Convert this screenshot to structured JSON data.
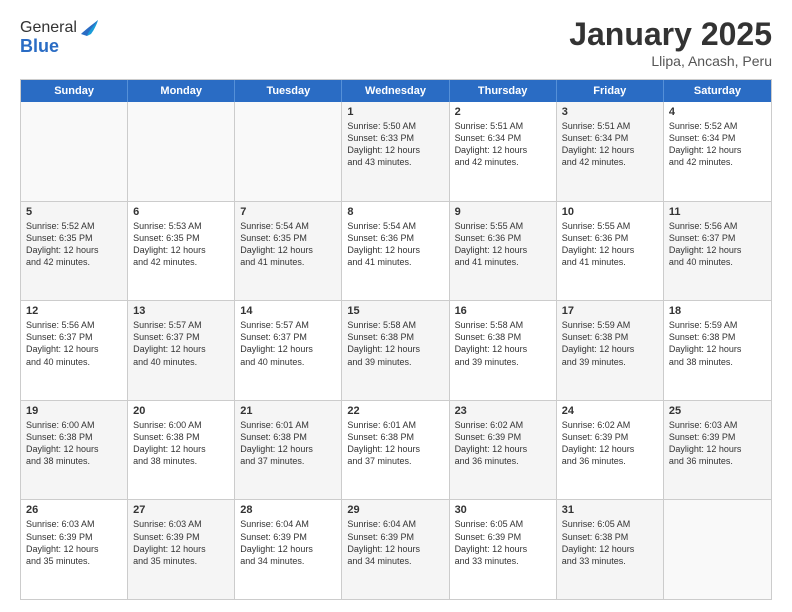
{
  "header": {
    "logo_general": "General",
    "logo_blue": "Blue",
    "title": "January 2025",
    "subtitle": "Llipa, Ancash, Peru"
  },
  "days": [
    "Sunday",
    "Monday",
    "Tuesday",
    "Wednesday",
    "Thursday",
    "Friday",
    "Saturday"
  ],
  "rows": [
    [
      {
        "num": "",
        "text": "",
        "empty": true
      },
      {
        "num": "",
        "text": "",
        "empty": true
      },
      {
        "num": "",
        "text": "",
        "empty": true
      },
      {
        "num": "1",
        "text": "Sunrise: 5:50 AM\nSunset: 6:33 PM\nDaylight: 12 hours\nand 43 minutes.",
        "shaded": true
      },
      {
        "num": "2",
        "text": "Sunrise: 5:51 AM\nSunset: 6:34 PM\nDaylight: 12 hours\nand 42 minutes."
      },
      {
        "num": "3",
        "text": "Sunrise: 5:51 AM\nSunset: 6:34 PM\nDaylight: 12 hours\nand 42 minutes.",
        "shaded": true
      },
      {
        "num": "4",
        "text": "Sunrise: 5:52 AM\nSunset: 6:34 PM\nDaylight: 12 hours\nand 42 minutes."
      }
    ],
    [
      {
        "num": "5",
        "text": "Sunrise: 5:52 AM\nSunset: 6:35 PM\nDaylight: 12 hours\nand 42 minutes.",
        "shaded": true
      },
      {
        "num": "6",
        "text": "Sunrise: 5:53 AM\nSunset: 6:35 PM\nDaylight: 12 hours\nand 42 minutes."
      },
      {
        "num": "7",
        "text": "Sunrise: 5:54 AM\nSunset: 6:35 PM\nDaylight: 12 hours\nand 41 minutes.",
        "shaded": true
      },
      {
        "num": "8",
        "text": "Sunrise: 5:54 AM\nSunset: 6:36 PM\nDaylight: 12 hours\nand 41 minutes."
      },
      {
        "num": "9",
        "text": "Sunrise: 5:55 AM\nSunset: 6:36 PM\nDaylight: 12 hours\nand 41 minutes.",
        "shaded": true
      },
      {
        "num": "10",
        "text": "Sunrise: 5:55 AM\nSunset: 6:36 PM\nDaylight: 12 hours\nand 41 minutes."
      },
      {
        "num": "11",
        "text": "Sunrise: 5:56 AM\nSunset: 6:37 PM\nDaylight: 12 hours\nand 40 minutes.",
        "shaded": true
      }
    ],
    [
      {
        "num": "12",
        "text": "Sunrise: 5:56 AM\nSunset: 6:37 PM\nDaylight: 12 hours\nand 40 minutes."
      },
      {
        "num": "13",
        "text": "Sunrise: 5:57 AM\nSunset: 6:37 PM\nDaylight: 12 hours\nand 40 minutes.",
        "shaded": true
      },
      {
        "num": "14",
        "text": "Sunrise: 5:57 AM\nSunset: 6:37 PM\nDaylight: 12 hours\nand 40 minutes."
      },
      {
        "num": "15",
        "text": "Sunrise: 5:58 AM\nSunset: 6:38 PM\nDaylight: 12 hours\nand 39 minutes.",
        "shaded": true
      },
      {
        "num": "16",
        "text": "Sunrise: 5:58 AM\nSunset: 6:38 PM\nDaylight: 12 hours\nand 39 minutes."
      },
      {
        "num": "17",
        "text": "Sunrise: 5:59 AM\nSunset: 6:38 PM\nDaylight: 12 hours\nand 39 minutes.",
        "shaded": true
      },
      {
        "num": "18",
        "text": "Sunrise: 5:59 AM\nSunset: 6:38 PM\nDaylight: 12 hours\nand 38 minutes."
      }
    ],
    [
      {
        "num": "19",
        "text": "Sunrise: 6:00 AM\nSunset: 6:38 PM\nDaylight: 12 hours\nand 38 minutes.",
        "shaded": true
      },
      {
        "num": "20",
        "text": "Sunrise: 6:00 AM\nSunset: 6:38 PM\nDaylight: 12 hours\nand 38 minutes."
      },
      {
        "num": "21",
        "text": "Sunrise: 6:01 AM\nSunset: 6:38 PM\nDaylight: 12 hours\nand 37 minutes.",
        "shaded": true
      },
      {
        "num": "22",
        "text": "Sunrise: 6:01 AM\nSunset: 6:38 PM\nDaylight: 12 hours\nand 37 minutes."
      },
      {
        "num": "23",
        "text": "Sunrise: 6:02 AM\nSunset: 6:39 PM\nDaylight: 12 hours\nand 36 minutes.",
        "shaded": true
      },
      {
        "num": "24",
        "text": "Sunrise: 6:02 AM\nSunset: 6:39 PM\nDaylight: 12 hours\nand 36 minutes."
      },
      {
        "num": "25",
        "text": "Sunrise: 6:03 AM\nSunset: 6:39 PM\nDaylight: 12 hours\nand 36 minutes.",
        "shaded": true
      }
    ],
    [
      {
        "num": "26",
        "text": "Sunrise: 6:03 AM\nSunset: 6:39 PM\nDaylight: 12 hours\nand 35 minutes."
      },
      {
        "num": "27",
        "text": "Sunrise: 6:03 AM\nSunset: 6:39 PM\nDaylight: 12 hours\nand 35 minutes.",
        "shaded": true
      },
      {
        "num": "28",
        "text": "Sunrise: 6:04 AM\nSunset: 6:39 PM\nDaylight: 12 hours\nand 34 minutes."
      },
      {
        "num": "29",
        "text": "Sunrise: 6:04 AM\nSunset: 6:39 PM\nDaylight: 12 hours\nand 34 minutes.",
        "shaded": true
      },
      {
        "num": "30",
        "text": "Sunrise: 6:05 AM\nSunset: 6:39 PM\nDaylight: 12 hours\nand 33 minutes."
      },
      {
        "num": "31",
        "text": "Sunrise: 6:05 AM\nSunset: 6:38 PM\nDaylight: 12 hours\nand 33 minutes.",
        "shaded": true
      },
      {
        "num": "",
        "text": "",
        "empty": true
      }
    ]
  ]
}
